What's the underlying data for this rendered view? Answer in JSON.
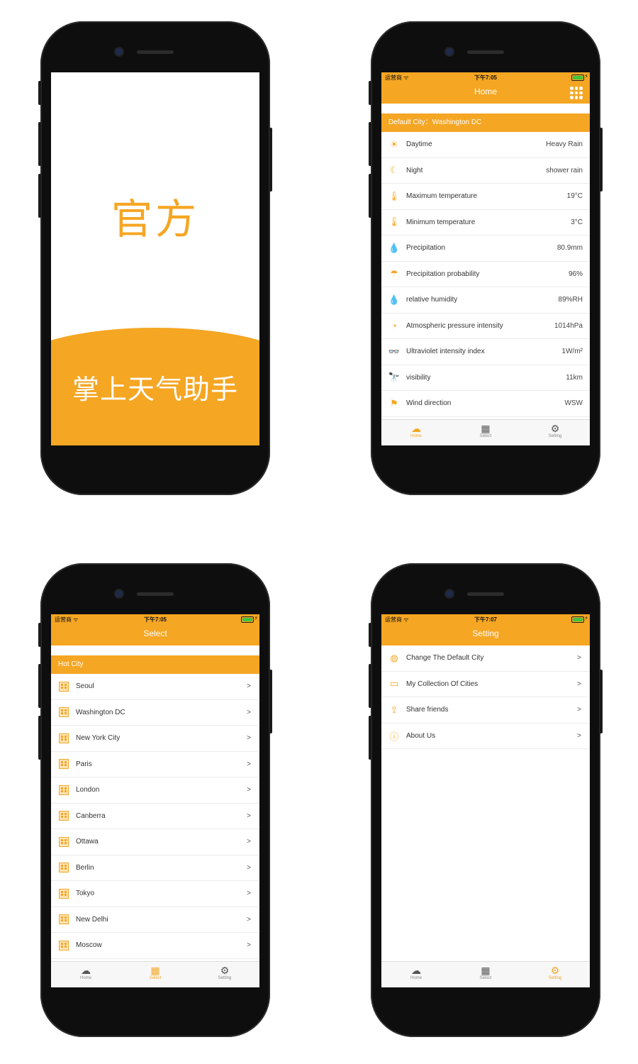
{
  "splash": {
    "title": "官方",
    "subtitle": "掌上天气助手"
  },
  "status": {
    "carrier": "运营商 ᯤ",
    "time_home": "下午7:05",
    "time_select": "下午7:05",
    "time_setting": "下午7:07",
    "bolt": "⚡"
  },
  "home": {
    "nav_title": "Home",
    "default_city": "Default City：Washington DC",
    "rows": [
      {
        "icon": "sun-icon",
        "glyph": "☀",
        "label": "Daytime",
        "value": "Heavy Rain"
      },
      {
        "icon": "moon-icon",
        "glyph": "☾",
        "label": "Night",
        "value": "shower rain"
      },
      {
        "icon": "thermometer-icon",
        "glyph": "🌡",
        "label": "Maximum temperature",
        "value": "19°C"
      },
      {
        "icon": "thermometer-icon",
        "glyph": "🌡",
        "label": "Minimum temperature",
        "value": "3°C"
      },
      {
        "icon": "drops-icon",
        "glyph": "💧",
        "label": "Precipitation",
        "value": "80.9mm"
      },
      {
        "icon": "umbrella-icon",
        "glyph": "☂",
        "label": "Precipitation probability",
        "value": "96%"
      },
      {
        "icon": "droplet-icon",
        "glyph": "💧",
        "label": "relative humidity",
        "value": "89%RH"
      },
      {
        "icon": "gauge-icon",
        "glyph": "◔",
        "label": "Atmospheric pressure intensity",
        "value": "1014hPa"
      },
      {
        "icon": "glasses-icon",
        "glyph": "👓",
        "label": "Ultraviolet intensity index",
        "value": "1W/m²"
      },
      {
        "icon": "telescope-icon",
        "glyph": "🔭",
        "label": "visibility",
        "value": "11km"
      },
      {
        "icon": "windsock-icon",
        "glyph": "⚑",
        "label": "Wind direction",
        "value": "WSW"
      }
    ]
  },
  "select": {
    "nav_title": "Select",
    "section": "Hot City",
    "arrow": ">",
    "cities": [
      "Seoul",
      "Washington DC",
      "New York City",
      "Paris",
      "London",
      "Canberra",
      "Ottawa",
      "Berlin",
      "Tokyo",
      "New Delhi",
      "Moscow"
    ]
  },
  "setting": {
    "nav_title": "Setting",
    "arrow": ">",
    "items": [
      {
        "icon": "globe-icon",
        "glyph": "◍",
        "label": "Change The Default City"
      },
      {
        "icon": "collection-icon",
        "glyph": "▭",
        "label": "My Collection Of Cities"
      },
      {
        "icon": "share-icon",
        "glyph": "⇪",
        "label": "Share friends"
      },
      {
        "icon": "info-icon",
        "glyph": "ⓘ",
        "label": "About Us"
      }
    ]
  },
  "tabs": {
    "home": "Home",
    "select": "Select",
    "setting": "Setting"
  },
  "colors": {
    "accent": "#f5a623"
  }
}
